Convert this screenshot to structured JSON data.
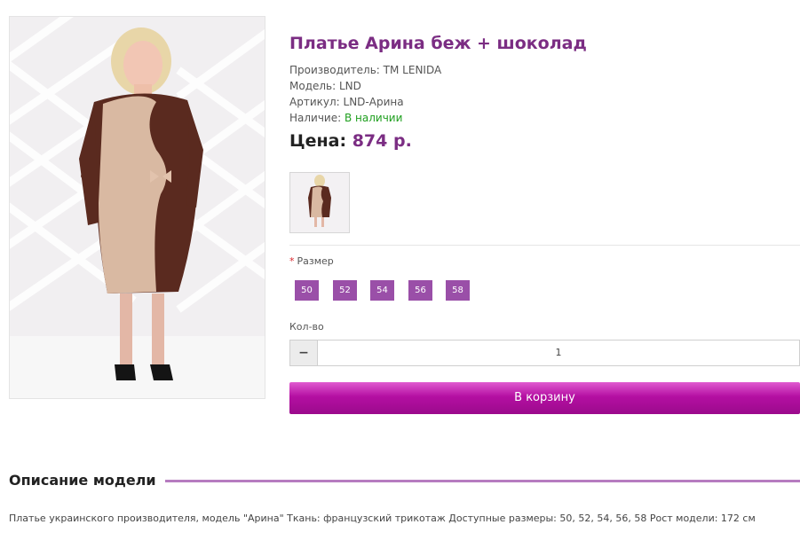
{
  "product": {
    "title": "Платье Арина беж + шоколад",
    "manufacturer_label": "Производитель:",
    "manufacturer": "ТМ LENIDA",
    "model_label": "Модель:",
    "model": "LND",
    "sku_label": "Артикул:",
    "sku": "LND-Арина",
    "availability_label": "Наличие:",
    "availability": "В наличии",
    "price_label": "Цена:",
    "price": "874 р."
  },
  "colors": {
    "title": "#7b2d83",
    "size_button": "#9a4fa8",
    "cart_button": "#b40fa2",
    "available": "#1e9f1e",
    "divider": "#b67cc0"
  },
  "options": {
    "size_label": "Размер",
    "required_mark": "*",
    "sizes": [
      "50",
      "52",
      "54",
      "56",
      "58"
    ]
  },
  "quantity": {
    "label": "Кол-во",
    "minus": "−",
    "value": "1"
  },
  "cart": {
    "button_label": "В корзину"
  },
  "description": {
    "heading": "Описание модели",
    "text": "Платье украинского производителя, модель \"Арина\" Ткань: французский трикотаж Доступные размеры: 50, 52, 54, 56, 58 Рост модели: 172 см"
  },
  "icons": {
    "main_image": "product-photo-dress",
    "thumbnail": "product-thumbnail"
  }
}
